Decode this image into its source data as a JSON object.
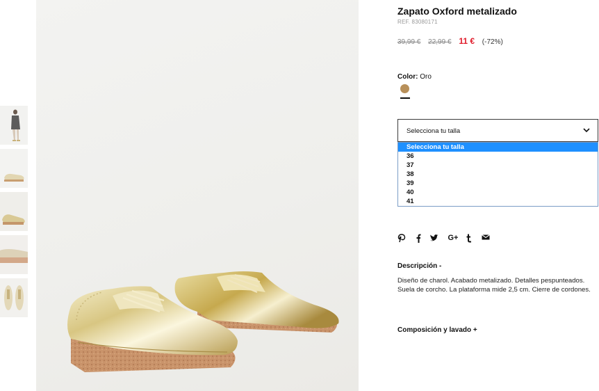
{
  "product": {
    "title": "Zapato Oxford metalizado",
    "ref": "REF. 83080171",
    "price_original": "39,99 €",
    "price_previous": "22,99 €",
    "price_current": "11 €",
    "discount": "(-72%)"
  },
  "color": {
    "label": "Color:",
    "value": "Oro",
    "swatch_hex": "#b8905a"
  },
  "size": {
    "placeholder": "Selecciona tu talla",
    "options": [
      "Selecciona tu talla",
      "36",
      "37",
      "38",
      "39",
      "40",
      "41"
    ],
    "selected_option": "Selecciona tu talla"
  },
  "share": {
    "icons": [
      "pinterest-icon",
      "facebook-icon",
      "twitter-icon",
      "google-plus-icon",
      "tumblr-icon",
      "email-icon"
    ]
  },
  "description": {
    "title": "Descripción -",
    "text": "Diseño de charol. Acabado metalizado. Detalles pespunteados. Suela de corcho. La plataforma mide 2,5 cm. Cierre de cordones."
  },
  "composition": {
    "title": "Composición y lavado +"
  },
  "colors": {
    "sale_price": "#e01b2a",
    "dropdown_highlight": "#1e90ff"
  }
}
